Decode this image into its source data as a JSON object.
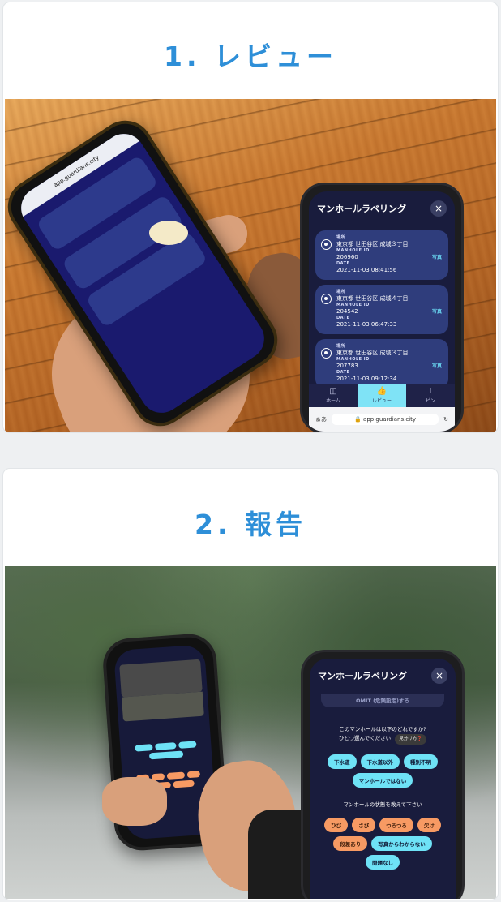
{
  "steps": [
    {
      "title": "1. レビュー",
      "mockup": {
        "screen_title": "マンホールラベリング",
        "close_icon": "×",
        "cards": [
          {
            "place_label": "場所",
            "place": "東京都 世田谷区 成城３丁目",
            "id_label": "MANHOLE ID",
            "id": "206960",
            "date_label": "DATE",
            "date": "2021-11-03 08:41:56",
            "photo_link": "写真"
          },
          {
            "place_label": "場所",
            "place": "東京都 世田谷区 成城４丁目",
            "id_label": "MANHOLE ID",
            "id": "204542",
            "date_label": "DATE",
            "date": "2021-11-03 06:47:33",
            "photo_link": "写真"
          },
          {
            "place_label": "場所",
            "place": "東京都 世田谷区 成城３丁目",
            "id_label": "MANHOLE ID",
            "id": "207783",
            "date_label": "DATE",
            "date": "2021-11-03 09:12:34",
            "photo_link": "写真"
          }
        ],
        "tabs": [
          {
            "icon": "map-icon",
            "glyph": "◫",
            "label": "ホーム"
          },
          {
            "icon": "thumbs-up-icon",
            "glyph": "👍",
            "label": "レビュー"
          },
          {
            "icon": "pin-icon",
            "glyph": "⊥",
            "label": "ピン"
          }
        ],
        "url_left": "ぁあ",
        "url": "app.guardians.city",
        "url_right": "↻"
      },
      "photo_phone_url": "app.guardians.city"
    },
    {
      "title": "2. 報告",
      "mockup": {
        "screen_title": "マンホールラベリング",
        "close_icon": "×",
        "omit_text": "OMIT (危険設定)する",
        "question1_line1": "このマンホールは以下のどれですか?",
        "question1_line2": "ひとつ選んでください",
        "hint_label": "見分け方❓",
        "type_options": [
          "下水道",
          "下水道以外",
          "種別不明",
          "マンホールではない"
        ],
        "question2": "マンホールの状態を教えて下さい",
        "condition_options": [
          "ひび",
          "さび",
          "つるつる",
          "欠け",
          "段差あり",
          "写真からわからない",
          "問題なし"
        ]
      }
    }
  ]
}
